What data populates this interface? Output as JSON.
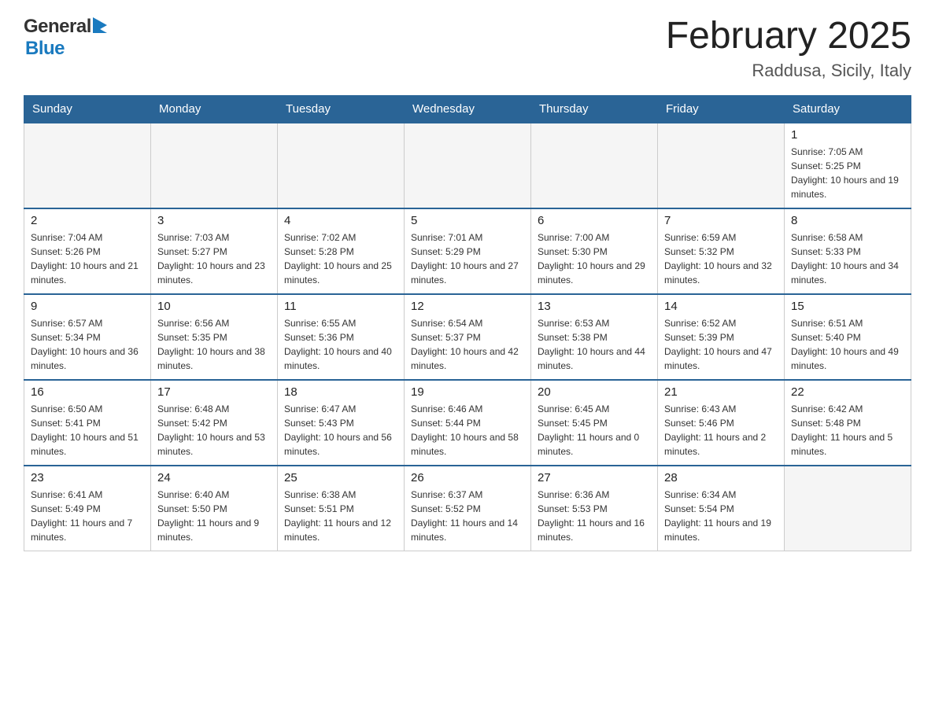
{
  "header": {
    "title": "February 2025",
    "location": "Raddusa, Sicily, Italy",
    "logo_general": "General",
    "logo_blue": "Blue"
  },
  "calendar": {
    "days_of_week": [
      "Sunday",
      "Monday",
      "Tuesday",
      "Wednesday",
      "Thursday",
      "Friday",
      "Saturday"
    ],
    "weeks": [
      {
        "days": [
          {
            "date": "",
            "info": ""
          },
          {
            "date": "",
            "info": ""
          },
          {
            "date": "",
            "info": ""
          },
          {
            "date": "",
            "info": ""
          },
          {
            "date": "",
            "info": ""
          },
          {
            "date": "",
            "info": ""
          },
          {
            "date": "1",
            "info": "Sunrise: 7:05 AM\nSunset: 5:25 PM\nDaylight: 10 hours and 19 minutes."
          }
        ]
      },
      {
        "days": [
          {
            "date": "2",
            "info": "Sunrise: 7:04 AM\nSunset: 5:26 PM\nDaylight: 10 hours and 21 minutes."
          },
          {
            "date": "3",
            "info": "Sunrise: 7:03 AM\nSunset: 5:27 PM\nDaylight: 10 hours and 23 minutes."
          },
          {
            "date": "4",
            "info": "Sunrise: 7:02 AM\nSunset: 5:28 PM\nDaylight: 10 hours and 25 minutes."
          },
          {
            "date": "5",
            "info": "Sunrise: 7:01 AM\nSunset: 5:29 PM\nDaylight: 10 hours and 27 minutes."
          },
          {
            "date": "6",
            "info": "Sunrise: 7:00 AM\nSunset: 5:30 PM\nDaylight: 10 hours and 29 minutes."
          },
          {
            "date": "7",
            "info": "Sunrise: 6:59 AM\nSunset: 5:32 PM\nDaylight: 10 hours and 32 minutes."
          },
          {
            "date": "8",
            "info": "Sunrise: 6:58 AM\nSunset: 5:33 PM\nDaylight: 10 hours and 34 minutes."
          }
        ]
      },
      {
        "days": [
          {
            "date": "9",
            "info": "Sunrise: 6:57 AM\nSunset: 5:34 PM\nDaylight: 10 hours and 36 minutes."
          },
          {
            "date": "10",
            "info": "Sunrise: 6:56 AM\nSunset: 5:35 PM\nDaylight: 10 hours and 38 minutes."
          },
          {
            "date": "11",
            "info": "Sunrise: 6:55 AM\nSunset: 5:36 PM\nDaylight: 10 hours and 40 minutes."
          },
          {
            "date": "12",
            "info": "Sunrise: 6:54 AM\nSunset: 5:37 PM\nDaylight: 10 hours and 42 minutes."
          },
          {
            "date": "13",
            "info": "Sunrise: 6:53 AM\nSunset: 5:38 PM\nDaylight: 10 hours and 44 minutes."
          },
          {
            "date": "14",
            "info": "Sunrise: 6:52 AM\nSunset: 5:39 PM\nDaylight: 10 hours and 47 minutes."
          },
          {
            "date": "15",
            "info": "Sunrise: 6:51 AM\nSunset: 5:40 PM\nDaylight: 10 hours and 49 minutes."
          }
        ]
      },
      {
        "days": [
          {
            "date": "16",
            "info": "Sunrise: 6:50 AM\nSunset: 5:41 PM\nDaylight: 10 hours and 51 minutes."
          },
          {
            "date": "17",
            "info": "Sunrise: 6:48 AM\nSunset: 5:42 PM\nDaylight: 10 hours and 53 minutes."
          },
          {
            "date": "18",
            "info": "Sunrise: 6:47 AM\nSunset: 5:43 PM\nDaylight: 10 hours and 56 minutes."
          },
          {
            "date": "19",
            "info": "Sunrise: 6:46 AM\nSunset: 5:44 PM\nDaylight: 10 hours and 58 minutes."
          },
          {
            "date": "20",
            "info": "Sunrise: 6:45 AM\nSunset: 5:45 PM\nDaylight: 11 hours and 0 minutes."
          },
          {
            "date": "21",
            "info": "Sunrise: 6:43 AM\nSunset: 5:46 PM\nDaylight: 11 hours and 2 minutes."
          },
          {
            "date": "22",
            "info": "Sunrise: 6:42 AM\nSunset: 5:48 PM\nDaylight: 11 hours and 5 minutes."
          }
        ]
      },
      {
        "days": [
          {
            "date": "23",
            "info": "Sunrise: 6:41 AM\nSunset: 5:49 PM\nDaylight: 11 hours and 7 minutes."
          },
          {
            "date": "24",
            "info": "Sunrise: 6:40 AM\nSunset: 5:50 PM\nDaylight: 11 hours and 9 minutes."
          },
          {
            "date": "25",
            "info": "Sunrise: 6:38 AM\nSunset: 5:51 PM\nDaylight: 11 hours and 12 minutes."
          },
          {
            "date": "26",
            "info": "Sunrise: 6:37 AM\nSunset: 5:52 PM\nDaylight: 11 hours and 14 minutes."
          },
          {
            "date": "27",
            "info": "Sunrise: 6:36 AM\nSunset: 5:53 PM\nDaylight: 11 hours and 16 minutes."
          },
          {
            "date": "28",
            "info": "Sunrise: 6:34 AM\nSunset: 5:54 PM\nDaylight: 11 hours and 19 minutes."
          },
          {
            "date": "",
            "info": ""
          }
        ]
      }
    ]
  }
}
